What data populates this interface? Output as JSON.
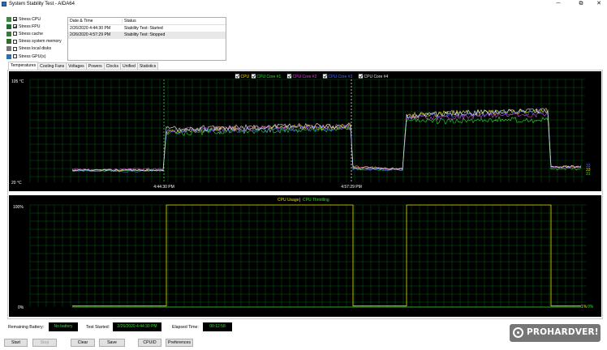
{
  "window": {
    "title": "System Stability Test - AIDA64",
    "minimize": "─",
    "maximize": "⧉",
    "close": "✕"
  },
  "stress_options": [
    {
      "label": "Stress CPU",
      "checked": true,
      "icon": "cpu-icon",
      "icon_color": "#3a8a3a"
    },
    {
      "label": "Stress FPU",
      "checked": true,
      "icon": "fpu-icon",
      "icon_color": "#1f6c2c"
    },
    {
      "label": "Stress cache",
      "checked": false,
      "icon": "cache-icon",
      "icon_color": "#3a7a3a"
    },
    {
      "label": "Stress system memory",
      "checked": false,
      "icon": "memory-icon",
      "icon_color": "#2f6b2f"
    },
    {
      "label": "Stress local disks",
      "checked": false,
      "icon": "disk-icon",
      "icon_color": "#777777"
    },
    {
      "label": "Stress GPU(s)",
      "checked": false,
      "icon": "gpu-icon",
      "icon_color": "#2e6fb0"
    }
  ],
  "log": {
    "col_datetime": "Date & Time",
    "col_status": "Status",
    "rows": [
      {
        "datetime": "2/26/2020 4:44:30 PM",
        "status": "Stability Test: Started"
      },
      {
        "datetime": "2/26/2020 4:57:29 PM",
        "status": "Stability Test: Stopped"
      }
    ]
  },
  "tabs": [
    "Temperatures",
    "Cooling Fans",
    "Voltages",
    "Powers",
    "Clocks",
    "Unified",
    "Statistics"
  ],
  "active_tab": "Temperatures",
  "temp_chart": {
    "y_top_label": "105 °C",
    "y_bottom_label": "20 °C",
    "x_labels": [
      "4:44:30 PM",
      "4:57:29 PM"
    ],
    "end_labels": [
      "33",
      "33",
      "31"
    ],
    "legend": [
      {
        "name": "CPU",
        "color": "#f0e000"
      },
      {
        "name": "CPU Core #1",
        "color": "#30e030"
      },
      {
        "name": "CPU Core #2",
        "color": "#e040e0"
      },
      {
        "name": "CPU Core #3",
        "color": "#4070ff"
      },
      {
        "name": "CPU Core #4",
        "color": "#e8e8e8"
      }
    ]
  },
  "usage_chart": {
    "legend_usage": "CPU Usage",
    "legend_separator": "|",
    "legend_throttling": "CPU Throttling",
    "y_top_label": "100%",
    "y_bottom_label": "0%",
    "end_label_usage": "1%",
    "end_label_throttling": "0%",
    "usage_color": "#e8e000",
    "throttling_color": "#30e030"
  },
  "chart_data": [
    {
      "type": "line",
      "title": "",
      "ylim": [
        20,
        105
      ],
      "grid": true,
      "legend_position": "top-center",
      "x_events": [
        "4:44:30 PM",
        "4:57:29 PM"
      ],
      "series": [
        {
          "name": "CPU",
          "values": [
            30,
            30,
            30,
            30,
            62,
            64,
            65,
            66,
            33,
            31,
            75,
            77,
            78,
            79,
            79,
            33,
            33
          ]
        },
        {
          "name": "CPU Core #1",
          "values": [
            30,
            29,
            30,
            30,
            60,
            62,
            63,
            64,
            31,
            30,
            72,
            70,
            72,
            71,
            72,
            31,
            31
          ]
        },
        {
          "name": "CPU Core #2",
          "values": [
            31,
            30,
            31,
            31,
            63,
            64,
            65,
            66,
            32,
            31,
            73,
            74,
            75,
            76,
            76,
            32,
            32
          ]
        },
        {
          "name": "CPU Core #3",
          "values": [
            29,
            30,
            29,
            30,
            62,
            63,
            64,
            65,
            31,
            30,
            74,
            76,
            77,
            78,
            78,
            33,
            33
          ]
        },
        {
          "name": "CPU Core #4",
          "values": [
            30,
            30,
            30,
            30,
            64,
            65,
            66,
            67,
            32,
            31,
            75,
            77,
            78,
            79,
            79,
            33,
            33
          ]
        }
      ]
    },
    {
      "type": "line",
      "title": "",
      "ylim": [
        0,
        100
      ],
      "grid": true,
      "legend_position": "top-center",
      "series": [
        {
          "name": "CPU Usage",
          "values": [
            1,
            1,
            1,
            1,
            100,
            100,
            100,
            100,
            1,
            1,
            100,
            100,
            100,
            100,
            100,
            1,
            1
          ]
        },
        {
          "name": "CPU Throttling",
          "values": [
            0,
            0,
            0,
            0,
            0,
            0,
            0,
            0,
            0,
            0,
            0,
            0,
            0,
            0,
            0,
            0,
            0
          ]
        }
      ]
    }
  ],
  "status": {
    "remaining_battery_label": "Remaining Battery:",
    "remaining_battery_value": "No battery",
    "test_started_label": "Test Started:",
    "test_started_value": "2/26/2020 4:44:30 PM",
    "elapsed_label": "Elapsed Time:",
    "elapsed_value": "00:12:58"
  },
  "buttons": {
    "start": "Start",
    "stop": "Stop",
    "clear": "Clear",
    "save": "Save",
    "cpuid": "CPUID",
    "preferences": "Preferences"
  },
  "watermark": "PROHARDVER!"
}
